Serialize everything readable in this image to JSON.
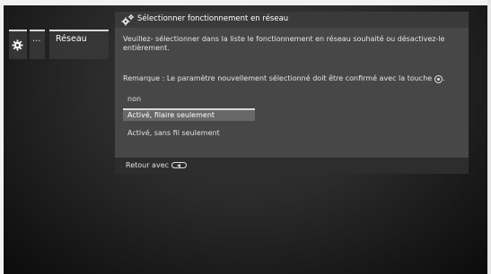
{
  "breadcrumb": {
    "icon": "gear-icon",
    "dots": "...",
    "section": "Réseau"
  },
  "dialog": {
    "title_icon": "gear-icon",
    "title": "Sélectionner fonctionnement en réseau",
    "instructions": "Veuillez- sélectionner dans la liste le fonctionnement en réseau souhaité ou désactivez-le entièrement.",
    "remark": "Remarque : Le paramètre nouvellement sélectionné doit être confirmé avec la touche",
    "remark_key_icon": "ok-button-icon",
    "remark_end": ".",
    "options": [
      "non",
      "Activé, filaire seulement",
      "Activé, sans fil seulement"
    ],
    "selected_index": 1,
    "footer_back": "Retour avec",
    "footer_key_icon": "back-button-icon"
  }
}
